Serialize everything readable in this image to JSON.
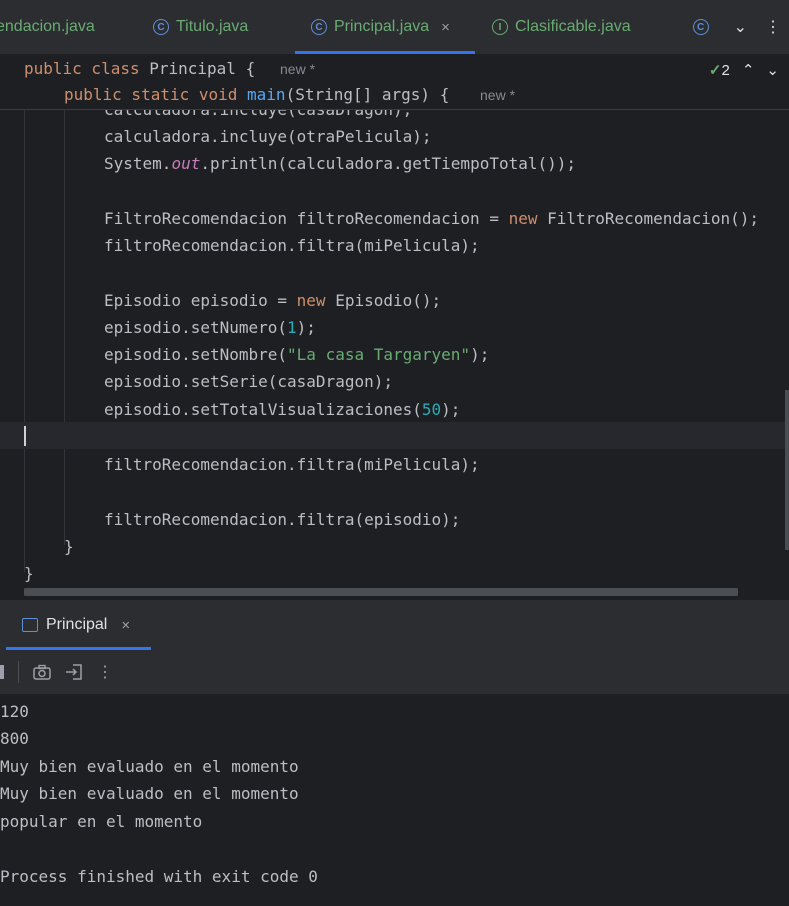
{
  "tabs": [
    {
      "label": "endacion.java",
      "icon": "class-icon"
    },
    {
      "label": "Titulo.java",
      "icon": "class-icon"
    },
    {
      "label": "Principal.java",
      "icon": "class-icon",
      "active": true
    },
    {
      "label": "Clasificable.java",
      "icon": "interface-icon"
    }
  ],
  "tab_close": "×",
  "tab_icon_c": "C",
  "tab_icon_i": "I",
  "sticky": {
    "line1": "public class Principal {",
    "line1_kw": "public class ",
    "line1_name": "Principal {",
    "line2_kw": "public static void ",
    "line2_fn": "main",
    "line2_rest": "(String[] args) {",
    "hint": "new *"
  },
  "inspection": {
    "count": "2",
    "check": "✓"
  },
  "code": {
    "l0": "calculadora.incluye(casaDragon);",
    "l1": "calculadora.incluye(otraPelicula);",
    "l2a": "System.",
    "l2b": "out",
    "l2c": ".println(calculadora.getTiempoTotal());",
    "l4a": "FiltroRecomendacion filtroRecomendacion = ",
    "l4kw": "new",
    "l4b": " FiltroRecomendacion();",
    "l5": "filtroRecomendacion.filtra(miPelicula);",
    "l7a": "Episodio episodio = ",
    "l7kw": "new",
    "l7b": " Episodio();",
    "l8a": "episodio.setNumero(",
    "l8n": "1",
    "l8b": ");",
    "l9a": "episodio.setNombre(",
    "l9s": "\"La casa Targaryen\"",
    "l9b": ");",
    "l10": "episodio.setSerie(casaDragon);",
    "l11a": "episodio.setTotalVisualizaciones(",
    "l11n": "50",
    "l11b": ");",
    "l13": "filtroRecomendacion.filtra(miPelicula);",
    "l15": "filtroRecomendacion.filtra(episodio);",
    "l16": "}",
    "l17": "}"
  },
  "run": {
    "tab_label": "Principal",
    "close": "×",
    "output": [
      "120",
      "800",
      "Muy bien evaluado en el momento",
      "Muy bien evaluado en el momento",
      "popular en el momento",
      "",
      "Process finished with exit code 0"
    ]
  }
}
